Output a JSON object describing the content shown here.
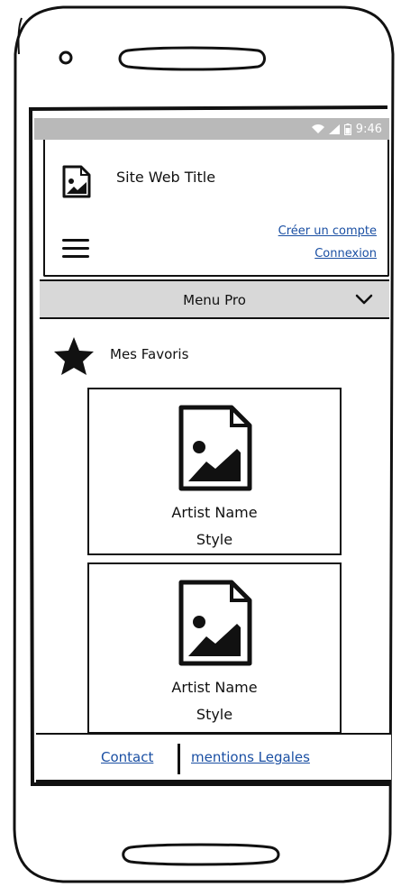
{
  "status_bar": {
    "time": "9:46",
    "icons": [
      "wifi-icon",
      "signal-icon",
      "battery-icon"
    ]
  },
  "header": {
    "logo_icon": "image-icon",
    "site_title": "Site Web Title",
    "menu_icon": "hamburger-menu-icon",
    "create_account_label": "Créer un compte",
    "login_label": "Connexion"
  },
  "menu_pro": {
    "label": "Menu Pro",
    "icon": "chevron-down-icon"
  },
  "favorites": {
    "icon": "star-icon",
    "label": "Mes Favoris",
    "items": [
      {
        "image_icon": "image-icon",
        "artist_name": "Artist Name",
        "style": "Style"
      },
      {
        "image_icon": "image-icon",
        "artist_name": "Artist Name",
        "style": "Style"
      }
    ]
  },
  "footer": {
    "contact_label": "Contact",
    "legal_label": "mentions Legales"
  },
  "colors": {
    "link": "#1a4fa3",
    "status_bar": "#b9b9b9",
    "menu_bar": "#d8d8d8",
    "ink": "#111111"
  }
}
